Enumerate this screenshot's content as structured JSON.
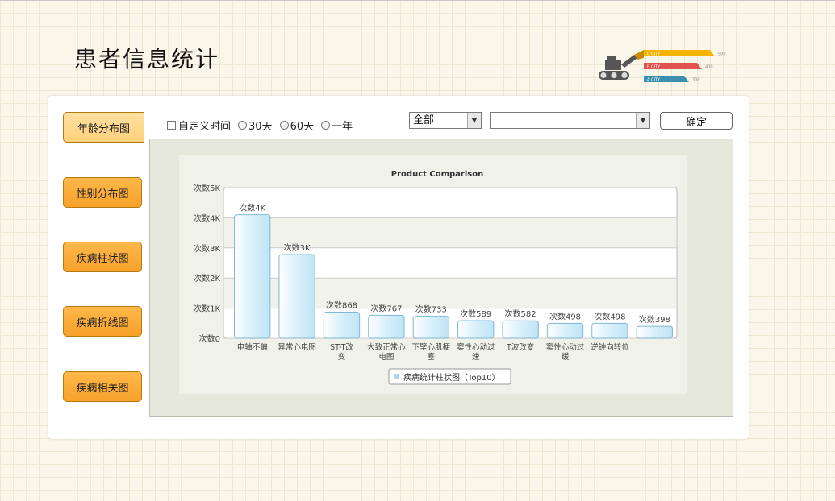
{
  "page": {
    "title": "患者信息统计"
  },
  "logo": {
    "bars": [
      {
        "label": "C CITY",
        "value": "500",
        "color": "#f4b400"
      },
      {
        "label": "B CITY",
        "value": "400",
        "color": "#e0534f"
      },
      {
        "label": "A CITY",
        "value": "300",
        "color": "#3d8fb0"
      }
    ]
  },
  "sidebar": {
    "items": [
      {
        "label": "年龄分布图",
        "active": true
      },
      {
        "label": "性别分布图",
        "active": false
      },
      {
        "label": "疾病柱状图",
        "active": false
      },
      {
        "label": "疾病折线图",
        "active": false
      },
      {
        "label": "疾病相关图",
        "active": false
      }
    ]
  },
  "toolbar": {
    "custom_time_label": "自定义时间",
    "radio_30": "30天",
    "radio_60": "60天",
    "radio_year": "一年",
    "select1_value": "全部",
    "select2_value": "",
    "confirm_label": "确定"
  },
  "chart_data": {
    "type": "bar",
    "title": "Product Comparison",
    "categories": [
      "电轴不偏",
      "异常心电图",
      "ST-T改变",
      "大致正常心电图",
      "下壁心肌梗塞",
      "窦性心动过速",
      "T波改变",
      "窦性心动过缓",
      "逆钟向转位",
      ""
    ],
    "series": [
      {
        "name": "疾病统计柱状图（Top10）",
        "values": [
          4100,
          2780,
          868,
          767,
          733,
          589,
          582,
          498,
          498,
          398
        ],
        "labels": [
          "次数4K",
          "次数3K",
          "次数868",
          "次数767",
          "次数733",
          "次数589",
          "次数582",
          "次数498",
          "次数498",
          "次数398"
        ]
      }
    ],
    "yticks": [
      "次数0",
      "次数1K",
      "次数2K",
      "次数3K",
      "次数4K",
      "次数5K"
    ],
    "ylim": [
      0,
      5000
    ],
    "grid": true,
    "legend_position": "bottom-center",
    "colors": {
      "bar_fill": "#d8f0fb",
      "bar_edge": "#7fb8d8",
      "legend_swatch": "#a9d7f2"
    }
  }
}
